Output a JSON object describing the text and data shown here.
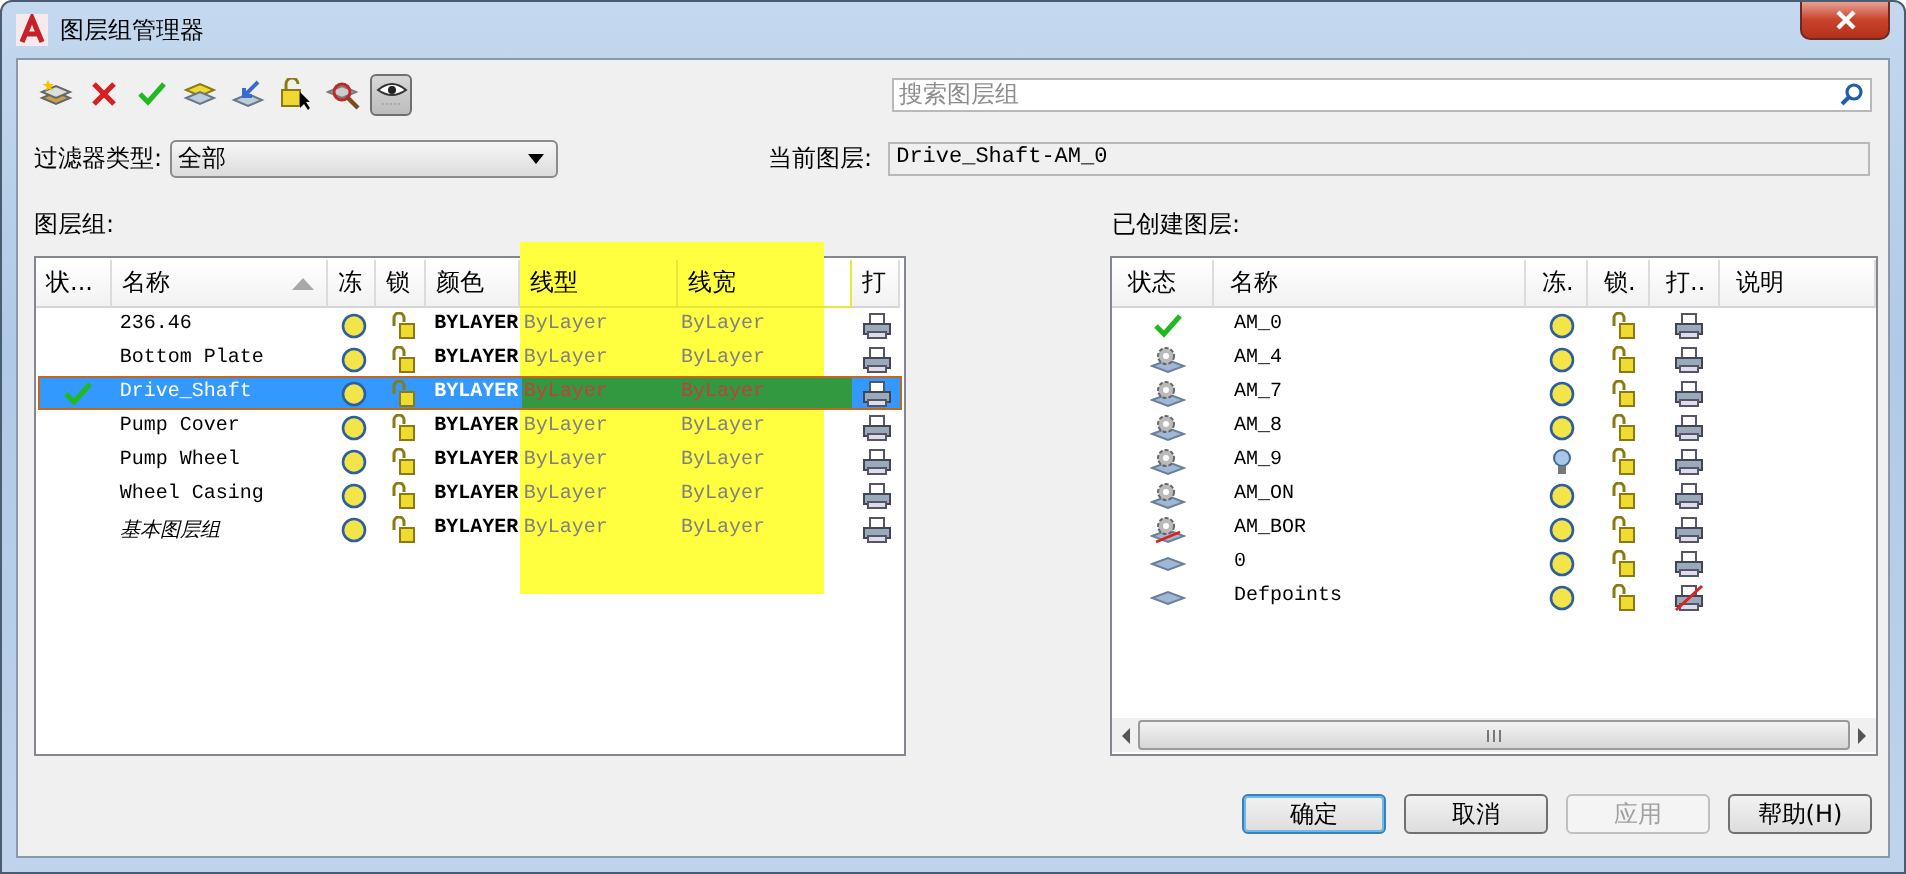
{
  "window": {
    "title": "图层组管理器"
  },
  "toolbar": {
    "preview_pressed": true
  },
  "search": {
    "placeholder": "搜索图层组"
  },
  "filter": {
    "label": "过滤器类型:",
    "value": "全部"
  },
  "current_layer": {
    "label": "当前图层:",
    "value": "Drive_Shaft-AM_0"
  },
  "groups": {
    "label": "图层组:",
    "columns": [
      "状...",
      "名称",
      "冻",
      "锁",
      "颜色",
      "线型",
      "线宽",
      "打"
    ],
    "rows": [
      {
        "name": "236.46",
        "current": false,
        "selected": false,
        "italic": false,
        "color_name": "BYLAYER",
        "linetype": "ByLayer",
        "lineweight": "ByLayer"
      },
      {
        "name": "Bottom Plate",
        "current": false,
        "selected": false,
        "italic": false,
        "color_name": "BYLAYER",
        "linetype": "ByLayer",
        "lineweight": "ByLayer"
      },
      {
        "name": "Drive_Shaft",
        "current": true,
        "selected": true,
        "italic": false,
        "color_name": "BYLAYER",
        "linetype": "ByLayer",
        "lineweight": "ByLayer"
      },
      {
        "name": "Pump Cover",
        "current": false,
        "selected": false,
        "italic": false,
        "color_name": "BYLAYER",
        "linetype": "ByLayer",
        "lineweight": "ByLayer"
      },
      {
        "name": "Pump Wheel",
        "current": false,
        "selected": false,
        "italic": false,
        "color_name": "BYLAYER",
        "linetype": "ByLayer",
        "lineweight": "ByLayer"
      },
      {
        "name": "Wheel Casing",
        "current": false,
        "selected": false,
        "italic": false,
        "color_name": "BYLAYER",
        "linetype": "ByLayer",
        "lineweight": "ByLayer"
      },
      {
        "name": "基本图层组",
        "current": false,
        "selected": false,
        "italic": true,
        "color_name": "BYLAYER",
        "linetype": "ByLayer",
        "lineweight": "ByLayer"
      }
    ]
  },
  "layers": {
    "label": "已创建图层:",
    "columns": [
      "状态",
      "名称",
      "冻.",
      "锁.",
      "打..",
      "说明"
    ],
    "rows": [
      {
        "name": "AM_0",
        "kind": "current",
        "off": false,
        "plot": true
      },
      {
        "name": "AM_4",
        "kind": "gear",
        "off": false,
        "plot": true
      },
      {
        "name": "AM_7",
        "kind": "gear",
        "off": false,
        "plot": true
      },
      {
        "name": "AM_8",
        "kind": "gear",
        "off": false,
        "plot": true
      },
      {
        "name": "AM_9",
        "kind": "gear",
        "off": true,
        "plot": true
      },
      {
        "name": "AM_ON",
        "kind": "gear",
        "off": false,
        "plot": true
      },
      {
        "name": "AM_BOR",
        "kind": "struck",
        "off": false,
        "plot": true
      },
      {
        "name": "0",
        "kind": "plain",
        "off": false,
        "plot": true
      },
      {
        "name": "Defpoints",
        "kind": "plain",
        "off": false,
        "plot": false
      }
    ]
  },
  "buttons": [
    {
      "label": "确定",
      "default": true,
      "disabled": false
    },
    {
      "label": "取消",
      "default": false,
      "disabled": false
    },
    {
      "label": "应用",
      "default": false,
      "disabled": true
    },
    {
      "label": "帮助(H)",
      "default": false,
      "disabled": false
    }
  ]
}
